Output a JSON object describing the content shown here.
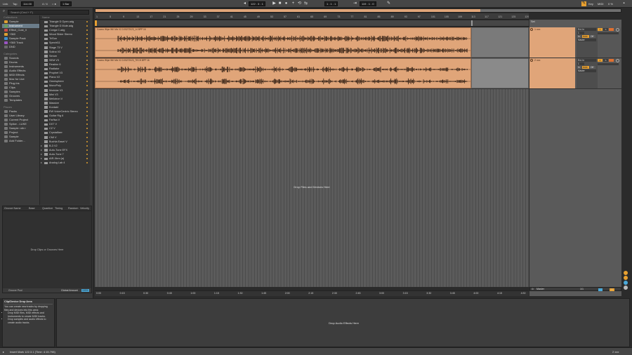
{
  "transport": {
    "link": "Link",
    "tap": "Tap",
    "tempo": "114.00",
    "time_sig": "4 / 4",
    "metro_dots": "○ ●",
    "quantize": "1 Bar",
    "position": "122 .  3 .  1",
    "loop_start": "1 .  1 .  1",
    "loop_length": "119 .  1 .  0",
    "key": "Key",
    "midi": "MIDI",
    "cpu": "0 %",
    "colors": {
      "record": "#e8a030"
    }
  },
  "browser": {
    "search_placeholder": "Search (Cmd + F)",
    "collections_header": "Collections",
    "collections": [
      "Sample",
      "Instrument",
      "Effect_Cust_ll",
      "+360",
      "Sample Pack",
      "+360 Track",
      "DND"
    ],
    "categories_header": "Categories",
    "categories": [
      "Sounds",
      "Drums",
      "Instruments",
      "Audio Effects",
      "MIDI Effects",
      "Max for Live",
      "Plug-Ins",
      "Clips",
      "Samples",
      "Grooves",
      "Templates"
    ],
    "places_header": "Places",
    "places": [
      "Packs",
      "User Library",
      "Current Project",
      "Splice - LUKE",
      "Sample <dir>",
      "Project",
      "Sample",
      "Add Folder..."
    ],
    "name_header": "Name",
    "items": [
      "Triangle D Open.adg",
      "Triangle D Mute.adg",
      "Conga C.adg",
      "Wood Slider Stereo",
      "TriSon",
      "Spectrl11",
      "Stage 73 V",
      "Solina V3",
      "Serum",
      "SEM V3",
      "Reaktor 6",
      "Radiator",
      "Prophet V3",
      "Piano V2",
      "Omnisphere",
      "MonoPoly",
      "Modular V3",
      "Mini V3",
      "Mellotron V",
      "Massive",
      "Kontakt",
      "EW VoiceCentric Stereo",
      "Guitar Rig 6",
      "Farfisa V",
      "DX7 V",
      "CZ V",
      "Crystallizer",
      "CMI V",
      "Buchla Easel V",
      "B-3 V2",
      "Auto-Tune EFX",
      "Auto-Tune 7",
      "AIR-Xtrm (a)",
      "Analog Lab 4"
    ]
  },
  "groove_pool": {
    "columns": [
      "Groove Name",
      "Base",
      "Quantize",
      "Timing",
      "Random",
      "Velocity"
    ],
    "drop_text": "Drop Clips or Grooves Here",
    "footer_left": "Groove Pool",
    "global_amount_label": "Global Amount",
    "global_amount_value": "100%"
  },
  "arrangement": {
    "bar_numbers": [
      "1",
      "5",
      "9",
      "13",
      "17",
      "21",
      "25",
      "29",
      "33",
      "37",
      "41",
      "45",
      "49",
      "53",
      "57",
      "61",
      "65",
      "69",
      "73",
      "77",
      "81",
      "85",
      "89",
      "93",
      "97",
      "101",
      "105",
      "109",
      "113",
      "117",
      "121",
      "125",
      "129"
    ],
    "time_labels": [
      "0:00",
      "0:15",
      "0:30",
      "0:45",
      "1:00",
      "1:15",
      "1:30",
      "1:45",
      "2:00",
      "2:15",
      "2:30",
      "2:45",
      "3:00",
      "3:15",
      "3:30",
      "3:45",
      "4:00",
      "4:15",
      "4:30"
    ],
    "clips": [
      {
        "title": "Cosmo Wipe WK Mix V2.3 05272023_14 BPP 16"
      },
      {
        "title": "Cosmo Wipe WK Mix V2.3 05272023_TECH BPP 16"
      }
    ],
    "drop_text": "Drop Files and Devices Here",
    "clip_color": "#e0a579"
  },
  "mixer": {
    "set_label": "Set",
    "tracks": [
      {
        "name": "1 xxx",
        "input": "Ext. In",
        "channel": "1",
        "monitor_in": "In",
        "monitor_auto": "Auto",
        "monitor_off": "Off",
        "output": "Master",
        "number": "1",
        "solo": "S"
      },
      {
        "name": "2 xxx",
        "input": "Ext. In",
        "channel": "1",
        "monitor_in": "In",
        "monitor_auto": "Auto",
        "monitor_off": "Off",
        "output": "Master",
        "number": "2",
        "solo": "S"
      }
    ],
    "master_label": "Master",
    "master_ratio": "1/1",
    "master_number": "0"
  },
  "info_view": {
    "title": "Clip/Device Drop Area",
    "body": "You can create new tracks by dropping files and devices into this area:",
    "bullets": [
      "Drop MIDI files, MIDI effects and Instruments to create MIDI tracks.",
      "Drop samples and audio effects to create audio tracks."
    ]
  },
  "device_view": {
    "drop_text": "Drop Audio Effects Here"
  },
  "status": {
    "left": "Insert Mark 122.3.1 (Time: 4:15.798)",
    "right": "2 xxx"
  }
}
